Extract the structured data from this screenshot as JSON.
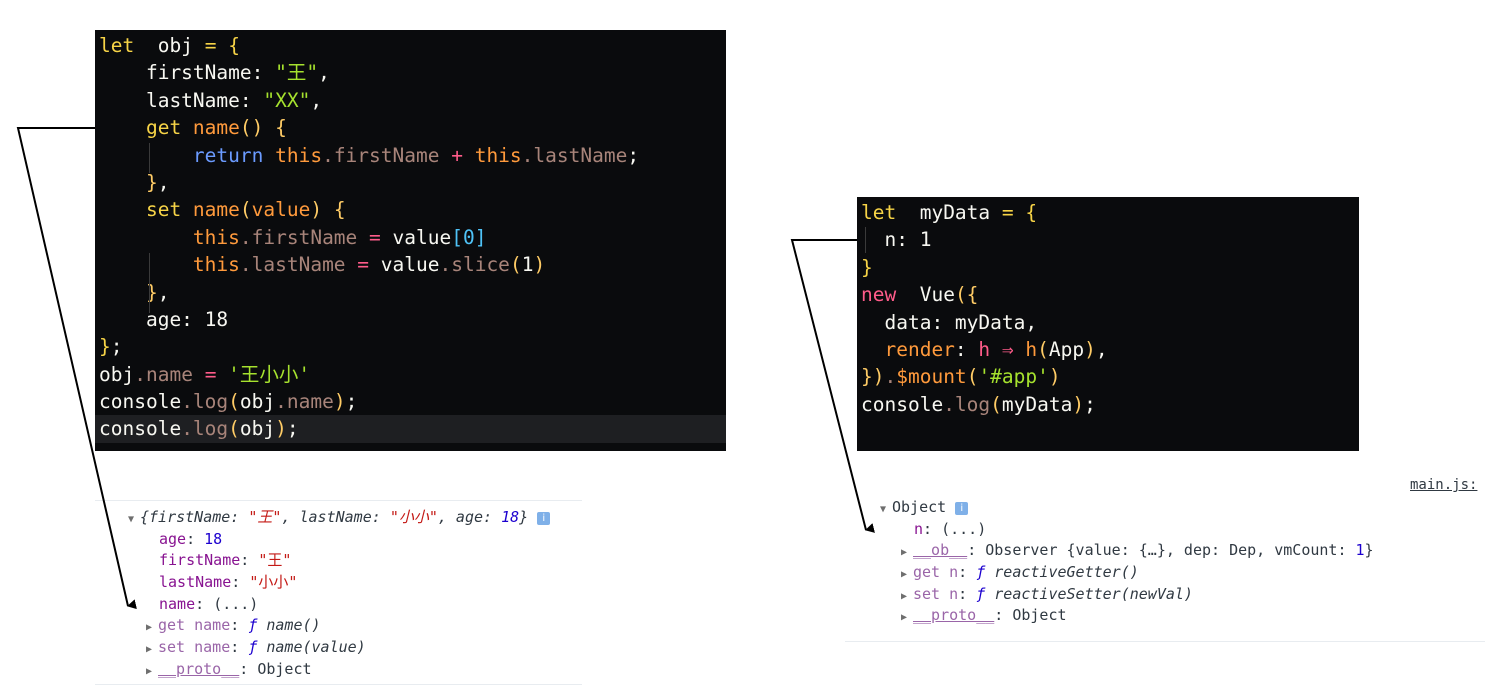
{
  "left_code": {
    "lines": [
      [
        [
          "kw",
          "let"
        ],
        [
          "",
          "  obj "
        ],
        [
          "punc",
          "="
        ],
        [
          "",
          " "
        ],
        [
          "punc",
          "{"
        ]
      ],
      [
        [
          "",
          "    firstName: "
        ],
        [
          "str",
          "\"王\""
        ],
        [
          "",
          ","
        ]
      ],
      [
        [
          "",
          "    lastName: "
        ],
        [
          "str",
          "\"XX\""
        ],
        [
          "",
          ","
        ]
      ],
      [
        [
          "kw",
          "    get "
        ],
        [
          "orange",
          "name"
        ],
        [
          "paren",
          "() {"
        ]
      ],
      [
        [
          "kw2",
          "        return "
        ],
        [
          "orange",
          "this"
        ],
        [
          "prop",
          ".firstName "
        ],
        [
          "pink",
          "+ "
        ],
        [
          "orange",
          "this"
        ],
        [
          "prop",
          ".lastName"
        ],
        [
          "",
          ";"
        ]
      ],
      [
        [
          "paren",
          "    }"
        ],
        [
          "",
          ","
        ]
      ],
      [
        [
          "kw",
          "    set "
        ],
        [
          "orange",
          "name"
        ],
        [
          "paren",
          "("
        ],
        [
          "orange",
          "value"
        ],
        [
          "paren",
          ") {"
        ]
      ],
      [
        [
          "orange",
          "        this"
        ],
        [
          "prop",
          ".firstName "
        ],
        [
          "pink",
          "= "
        ],
        [
          "",
          "value"
        ],
        [
          "brk",
          "[0]"
        ]
      ],
      [
        [
          "orange",
          "        this"
        ],
        [
          "prop",
          ".lastName "
        ],
        [
          "pink",
          "= "
        ],
        [
          "",
          "value"
        ],
        [
          "prop",
          ".slice"
        ],
        [
          "paren",
          "("
        ],
        [
          "",
          "1"
        ],
        [
          "paren",
          ")"
        ]
      ],
      [
        [
          "paren",
          "    }"
        ],
        [
          "",
          ","
        ]
      ],
      [
        [
          "",
          "    age: 18"
        ]
      ],
      [
        [
          "punc",
          "}"
        ],
        [
          "",
          ";"
        ]
      ],
      [
        [
          "",
          "obj"
        ],
        [
          "prop",
          ".name "
        ],
        [
          "pink",
          "= "
        ],
        [
          "str",
          "'王小小'"
        ]
      ],
      [
        [
          "",
          "console"
        ],
        [
          "prop",
          ".log"
        ],
        [
          "paren",
          "("
        ],
        [
          "",
          "obj"
        ],
        [
          "prop",
          ".name"
        ],
        [
          "paren",
          ")"
        ],
        [
          "",
          ";"
        ]
      ],
      [
        [
          "",
          "console"
        ],
        [
          "prop",
          ".log"
        ],
        [
          "paren",
          "("
        ],
        [
          "",
          "obj"
        ],
        [
          "paren",
          ")"
        ],
        [
          "",
          ";"
        ]
      ]
    ]
  },
  "right_code": {
    "lines": [
      [
        [
          "kw",
          "let"
        ],
        [
          "",
          "  myData "
        ],
        [
          "punc",
          "="
        ],
        [
          "",
          " "
        ],
        [
          "punc",
          "{"
        ]
      ],
      [
        [
          "",
          "  n: 1"
        ]
      ],
      [
        [
          "punc",
          "}"
        ]
      ],
      [
        [
          "pink",
          "new"
        ],
        [
          "",
          "  Vue"
        ],
        [
          "paren",
          "({"
        ]
      ],
      [
        [
          "",
          "  data: myData,"
        ]
      ],
      [
        [
          "orange",
          "  render"
        ],
        [
          "",
          ": "
        ],
        [
          "pink",
          "h ⇒ "
        ],
        [
          "orange",
          "h"
        ],
        [
          "paren",
          "("
        ],
        [
          "",
          "App"
        ],
        [
          "paren",
          ")"
        ],
        [
          "",
          ","
        ]
      ],
      [
        [
          "paren",
          "})"
        ],
        [
          "prop",
          "."
        ],
        [
          "orange",
          "$mount"
        ],
        [
          "paren",
          "("
        ],
        [
          "str",
          "'#app'"
        ],
        [
          "paren",
          ")"
        ]
      ],
      [
        [
          "",
          "console"
        ],
        [
          "prop",
          ".log"
        ],
        [
          "paren",
          "("
        ],
        [
          "",
          "myData"
        ],
        [
          "paren",
          ")"
        ],
        [
          "",
          ";"
        ]
      ]
    ]
  },
  "left_console": {
    "summary_prefix": "{firstName: ",
    "summary_first": "\"王\"",
    "summary_mid": ", lastName: ",
    "summary_last": "\"小小\"",
    "summary_age": ", age: ",
    "summary_age_val": "18",
    "summary_close": "}",
    "info": "i",
    "age_key": "age",
    "age_val": "18",
    "first_key": "firstName",
    "first_val": "\"王\"",
    "last_key": "lastName",
    "last_val": "\"小小\"",
    "name_key": "name",
    "name_val": "(...)",
    "get_key": "get name",
    "get_f": "ƒ",
    "get_fn": "name()",
    "set_key": "set name",
    "set_f": "ƒ",
    "set_fn": "name(value)",
    "proto_key": "__proto__",
    "proto_val": "Object"
  },
  "right_console": {
    "file_link": "main.js:",
    "object_label": "Object",
    "info": "i",
    "n_key": "n",
    "n_val": "(...)",
    "ob_key": "__ob__",
    "ob_val_prefix": "Observer {value: {…}, dep: Dep, vmCount: ",
    "ob_val_num": "1",
    "ob_val_close": "}",
    "get_key": "get n",
    "get_f": "ƒ",
    "get_fn": "reactiveGetter()",
    "set_key": "set n",
    "set_f": "ƒ",
    "set_fn": "reactiveSetter(newVal)",
    "proto_key": "__proto__",
    "proto_val": "Object"
  },
  "colors": {
    "code_bg": "#0a0b0d",
    "console_text": "#303942",
    "key_purple": "#881391",
    "string_red": "#c41a16",
    "number_blue": "#1c00cf"
  }
}
